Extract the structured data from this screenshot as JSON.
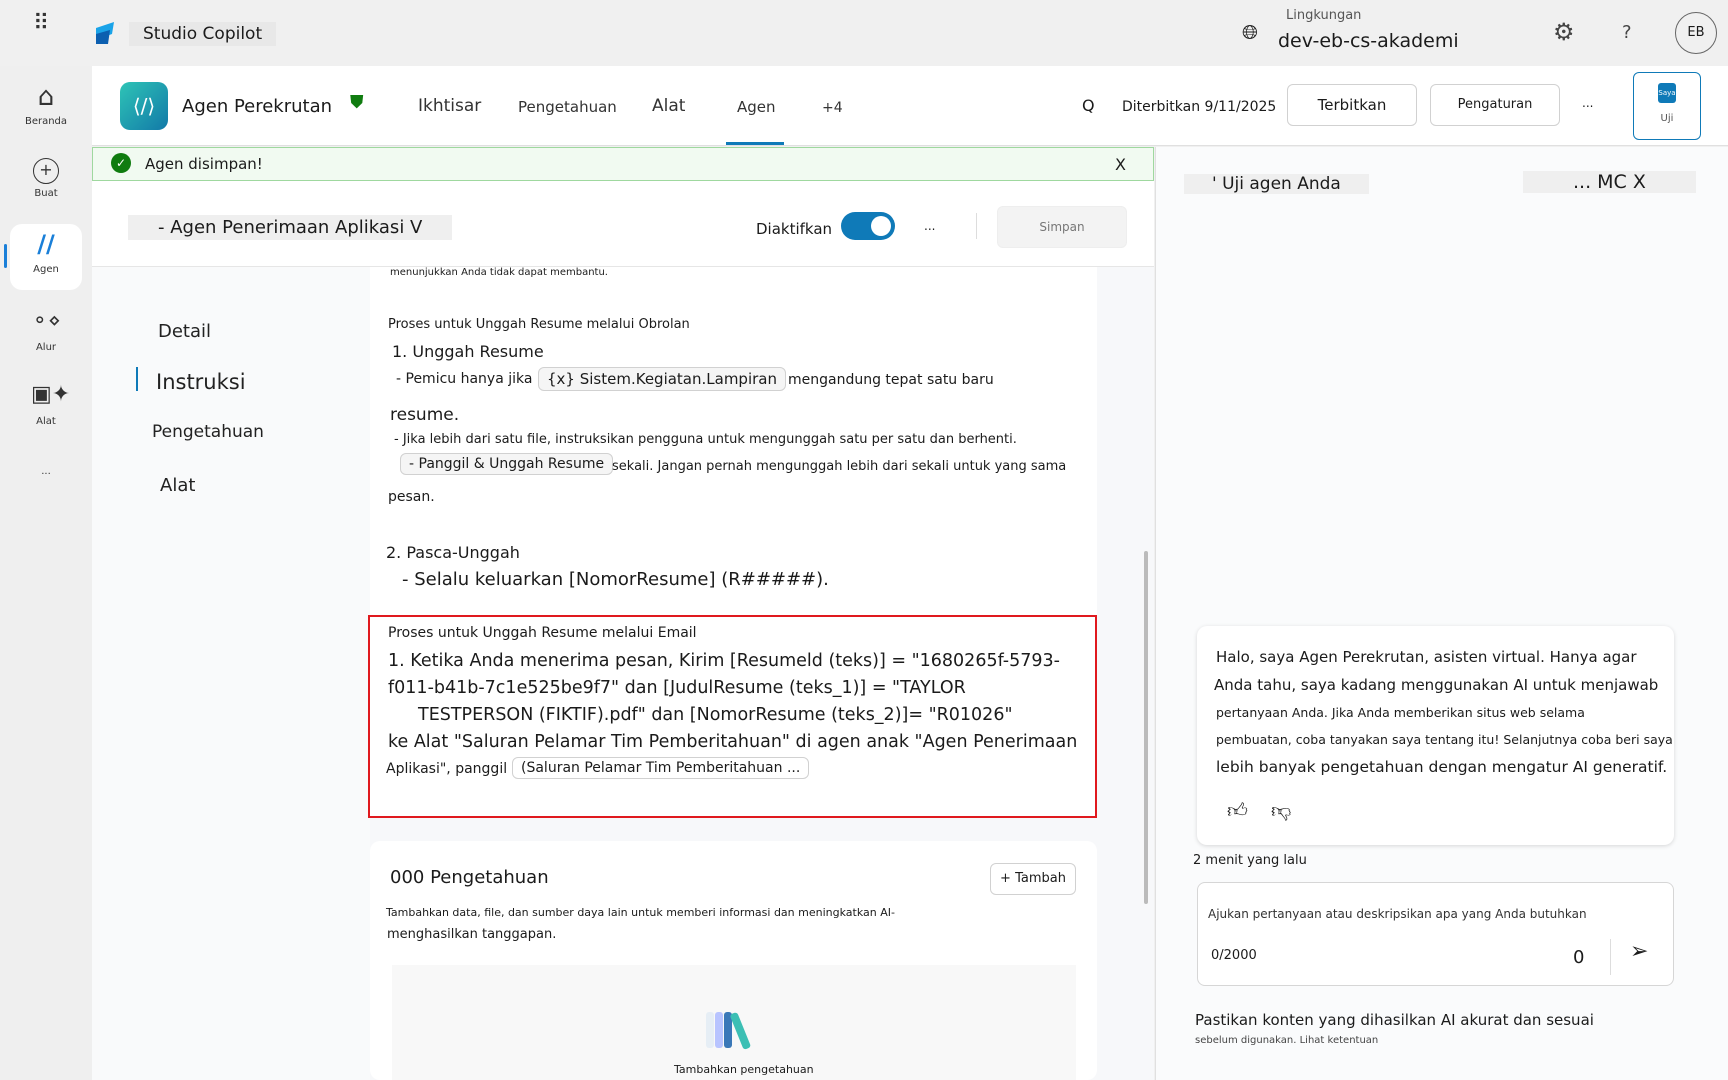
{
  "app": {
    "name": "Studio Copilot",
    "env_label": "Lingkungan",
    "env_value": "dev-eb-cs-akademi",
    "avatar": "EB"
  },
  "rail": [
    {
      "label": "Beranda"
    },
    {
      "label": "Buat"
    },
    {
      "label": "Agen"
    },
    {
      "label": "Alur"
    },
    {
      "label": "Alat"
    },
    {
      "label": "..."
    }
  ],
  "header": {
    "agent_name": "Agen Perekrutan",
    "tabs": [
      "Ikhtisar",
      "Pengetahuan",
      "Alat",
      "Agen",
      "+4"
    ],
    "search": "Q",
    "published": "Diterbitkan 9/11/2025",
    "publish": "Terbitkan",
    "settings": "Pengaturan",
    "more": "...",
    "test_top": "Saya",
    "test": "Uji"
  },
  "toast": {
    "text": "Agen disimpan!",
    "close": "X"
  },
  "agent": {
    "title": "- Agen Penerimaan Aplikasi V",
    "enabled_label": "Diaktifkan",
    "more": "...",
    "save": "Simpan",
    "enabled": true
  },
  "nav": [
    "Detail",
    "Instruksi",
    "Pengetahuan",
    "Alat"
  ],
  "instructions": {
    "top": "menunjukkan Anda tidak dapat membantu.",
    "chat_title": "Proses untuk Unggah Resume melalui Obrolan",
    "s1": "1. Unggah Resume",
    "s1a": "- Pemicu hanya jika",
    "var": "{x} Sistem.Kegiatan.Lampiran",
    "s1b": "mengandung tepat satu baru",
    "s1c": "resume.",
    "s1d": "- Jika lebih dari satu file, instruksikan pengguna untuk mengunggah satu per satu dan berhenti.",
    "s1e": "- Panggil & Unggah Resume",
    "s1f": "sekali. Jangan pernah mengunggah lebih dari sekali untuk yang sama",
    "s1g": "pesan.",
    "s2": "2. Pasca-Unggah",
    "s2a": "- Selalu keluarkan [NomorResume] (R#####).",
    "email_title": "Proses untuk Unggah Resume melalui Email",
    "e1": "1. Ketika Anda menerima pesan, Kirim [Resumeld (teks)] = \"1680265f-5793-",
    "e2": "f011-b41b-7c1e525be9f7\" dan [JudulResume (teks_1)] = \"TAYLOR",
    "e3": "TESTPERSON (FIKTIF).pdf\" dan [NomorResume (teks_2)]= \"R01026\"",
    "e4": "ke Alat \"Saluran Pelamar Tim Pemberitahuan\" di agen anak \"Agen Penerimaan",
    "e5": "Aplikasi\", panggil",
    "e5chip": "(Saluran Pelamar Tim Pemberitahuan ..."
  },
  "knowledge": {
    "title": "000 Pengetahuan",
    "add": "+ Tambah",
    "desc1": "Tambahkan data, file, dan sumber daya lain untuk memberi informasi dan meningkatkan AI-",
    "desc2": "menghasilkan tanggapan.",
    "empty": "Tambahkan pengetahuan"
  },
  "test": {
    "title": "' Uji agen Anda",
    "controls": "... MC X",
    "msg": [
      "Halo, saya Agen Perekrutan, asisten virtual. Hanya agar",
      "Anda tahu, saya kadang menggunakan AI untuk menjawab",
      "pertanyaan Anda. Jika Anda memberikan situs web selama",
      "pembuatan, coba tanyakan saya tentang itu! Selanjutnya coba beri saya",
      "lebih banyak pengetahuan dengan mengatur AI generatif."
    ],
    "time": "2 menit yang lalu",
    "placeholder": "Ajukan pertanyaan atau deskripsikan apa yang Anda butuhkan",
    "count": "0/2000",
    "attach": "0",
    "disclaimer1": "Pastikan konten yang dihasilkan AI akurat dan sesuai",
    "disclaimer2": "sebelum digunakan. Lihat ketentuan"
  }
}
